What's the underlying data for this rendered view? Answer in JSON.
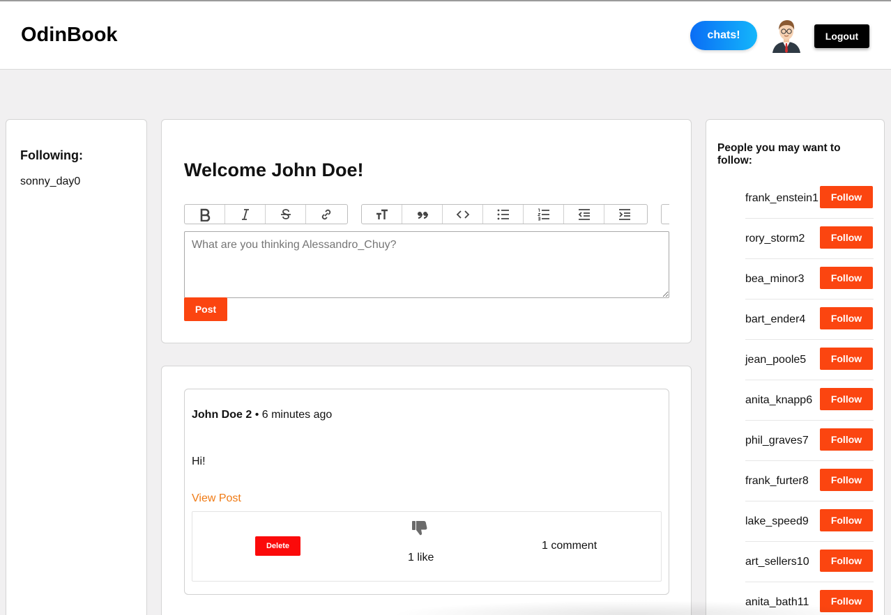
{
  "header": {
    "brand": "OdinBook",
    "chats_label": "chats!",
    "logout_label": "Logout"
  },
  "following": {
    "title": "Following:",
    "users": [
      "sonny_day0"
    ]
  },
  "compose": {
    "welcome": "Welcome John Doe!",
    "placeholder": "What are you thinking Alessandro_Chuy?",
    "post_label": "Post",
    "toolbar_icons": [
      "bold-icon",
      "italic-icon",
      "strikethrough-icon",
      "link-icon",
      "heading-icon",
      "quote-icon",
      "code-icon",
      "bullet-list-icon",
      "numbered-list-icon",
      "outdent-icon",
      "indent-icon"
    ]
  },
  "feed": {
    "posts": [
      {
        "author": "John Doe 2",
        "separator": "•",
        "time": "6 minutes ago",
        "body": "Hi!",
        "view_label": "View Post",
        "delete_label": "Delete",
        "likes": "1 like",
        "comments": "1 comment"
      }
    ]
  },
  "suggestions": {
    "title": "People you may want to follow:",
    "follow_label": "Follow",
    "users": [
      "frank_enstein1",
      "rory_storm2",
      "bea_minor3",
      "bart_ender4",
      "jean_poole5",
      "anita_knapp6",
      "phil_graves7",
      "frank_furter8",
      "lake_speed9",
      "art_sellers10",
      "anita_bath11"
    ]
  },
  "colors": {
    "accent": "#fb4510",
    "delete": "#fb0a0a",
    "link": "#f07a14",
    "chats_gradient_start": "#0a6df5",
    "chats_gradient_end": "#14b6fb"
  }
}
